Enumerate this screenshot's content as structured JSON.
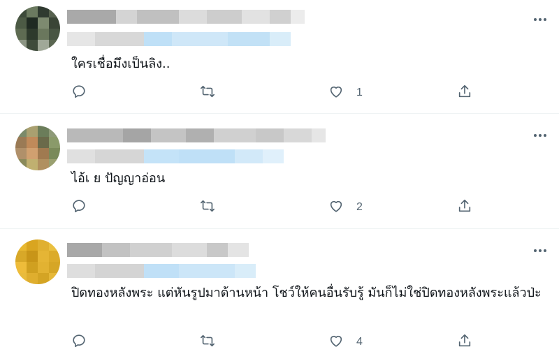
{
  "tweets": [
    {
      "text": "ใครเชื่อมึงเป็นลิง..",
      "like_count": "1",
      "avatar_colors": [
        "#3d4a3a",
        "#6b7a60",
        "#2f3a30",
        "#56614e",
        "#4c5a45",
        "#1f2a22",
        "#7d8a70",
        "#3a4536",
        "#5e6b52",
        "#2e3a2c",
        "#6a775d",
        "#485543",
        "#8c9584",
        "#3f4b3b",
        "#a0a898",
        "#5a6651"
      ]
    },
    {
      "text": "ไอ้เ  ย ปัญญาอ่อน",
      "like_count": "2",
      "avatar_colors": [
        "#7a8a6a",
        "#a9a070",
        "#6b7d5a",
        "#8e9a78",
        "#9a7a55",
        "#c08a5a",
        "#6a6a4a",
        "#8a9a6a",
        "#b0906a",
        "#d0a070",
        "#a07a50",
        "#7a8a5a",
        "#8a8a5a",
        "#c0b070",
        "#b09060",
        "#9aa070"
      ]
    },
    {
      "text": "ปิดทองหลังพระ แต่หันรูปมาด้านหน้า โชว์ให้คนอื่นรับรู้ มันก็ไม่ใช่ปิดทองหลังพระแล้วป่ะ",
      "like_count": "4",
      "avatar_colors": [
        "#e8b830",
        "#d9a520",
        "#e0b030",
        "#eac040",
        "#d8a828",
        "#c89518",
        "#e5b535",
        "#dcab2a",
        "#eebc3a",
        "#d0a020",
        "#e2b232",
        "#d6a626",
        "#e9bb3c",
        "#dfae2e",
        "#d4a424",
        "#e6b838"
      ]
    }
  ],
  "icons": {
    "reply": "reply-icon",
    "retweet": "retweet-icon",
    "like": "like-icon",
    "share": "share-icon",
    "more": "more-icon"
  },
  "colors": {
    "text": "#0f1419",
    "muted": "#536471",
    "divider": "#eff3f4",
    "blur_gray": "#c8c8c8",
    "blur_blue": "#bfe0f7"
  }
}
